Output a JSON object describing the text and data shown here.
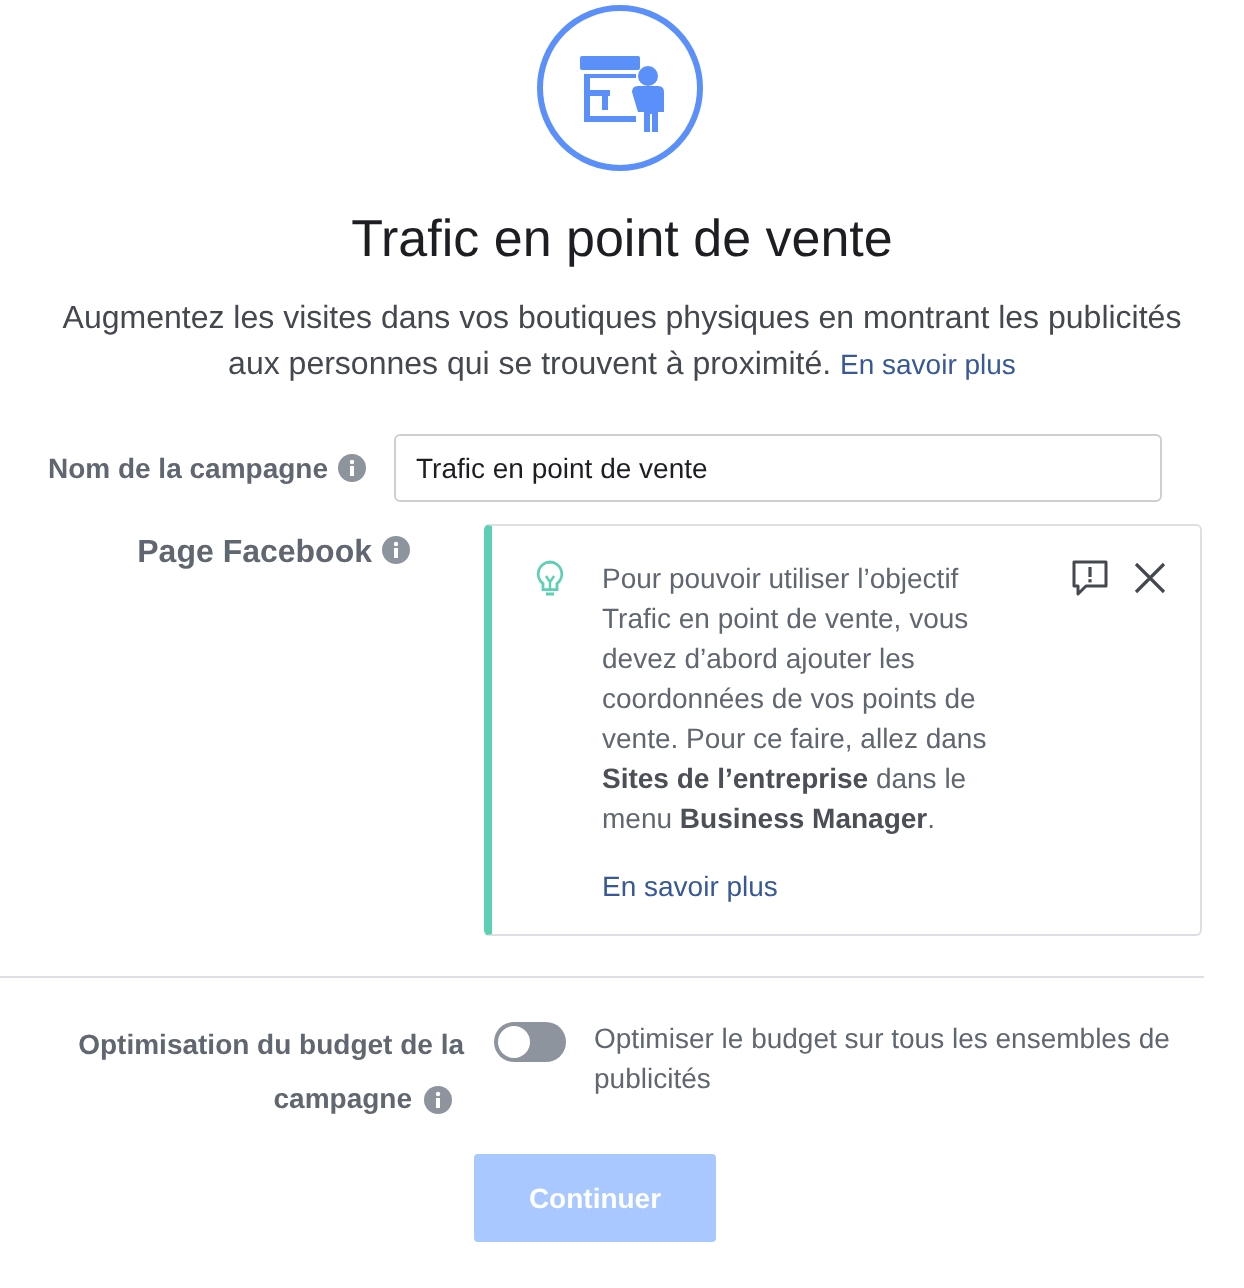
{
  "title": "Trafic en point de vente",
  "description": "Augmentez les visites dans vos boutiques physiques en montrant les publicités aux personnes qui se trouvent à proximité.",
  "description_link": "En savoir plus",
  "campaign_name": {
    "label": "Nom de la campagne",
    "value": "Trafic en point de vente"
  },
  "facebook_page": {
    "label": "Page Facebook",
    "notice": {
      "text": "Pour pouvoir utiliser l’objectif Trafic en point de vente, vous devez d’abord ajouter les coordonnées de vos points de vente. Pour ce faire, allez dans **Sites de l’entreprise** dans le menu **Business Manager**.",
      "link": "En savoir plus"
    }
  },
  "budget_optimization": {
    "label_line_1": "Optimisation du budget de la",
    "label_line_2": "campagne",
    "on": false,
    "description": "Optimiser le budget sur tous les ensembles de publicités"
  },
  "continue_button": {
    "label": "Continuer",
    "disabled": true
  }
}
